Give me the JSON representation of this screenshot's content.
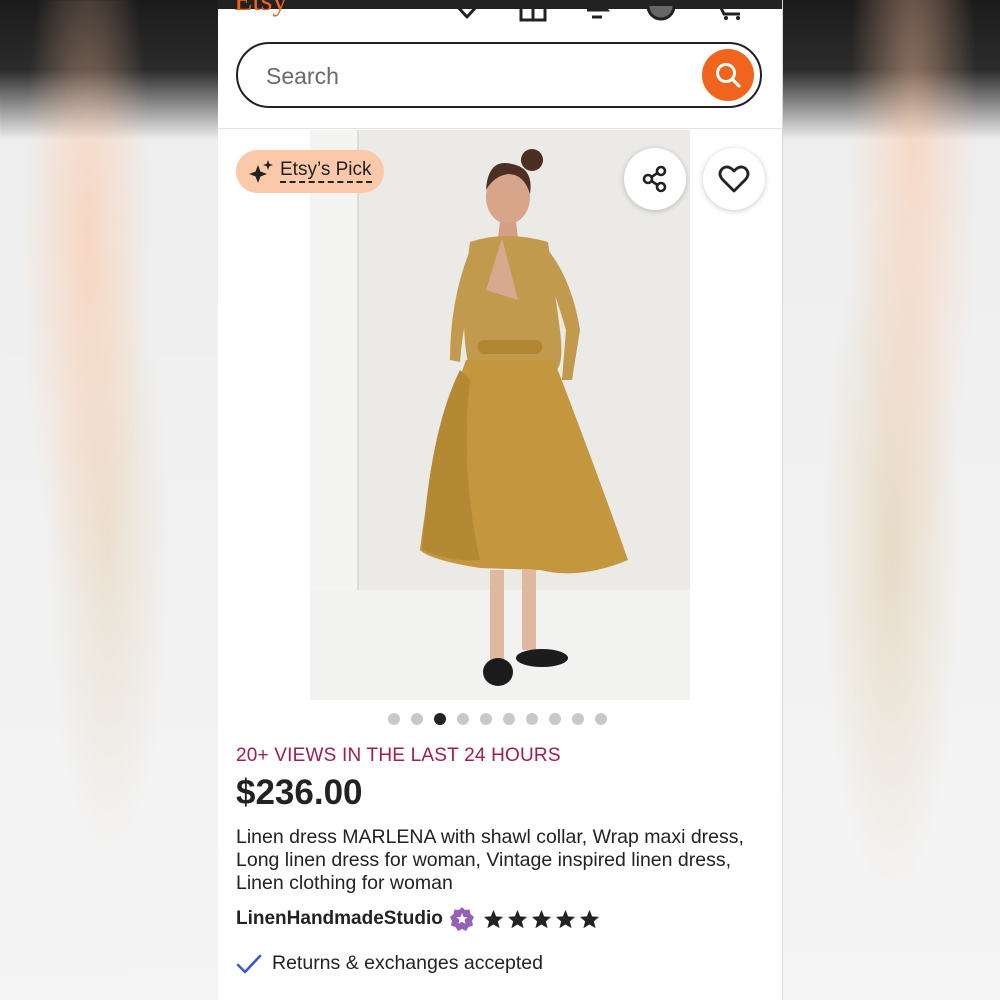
{
  "header": {
    "logo_text": "Etsy",
    "brand_color": "#f1641e",
    "icons": [
      "favorites-icon",
      "gift-icon",
      "notifications-icon",
      "account-icon",
      "cart-icon"
    ]
  },
  "search": {
    "placeholder": "Search",
    "value": ""
  },
  "listing": {
    "badge_label": "Etsy’s Pick",
    "badge_color": "#fbc9a9",
    "image_count": 10,
    "active_image_index": 2,
    "views_text": "20+ VIEWS IN THE LAST 24 HOURS",
    "views_color": "#a61a4f",
    "price": "$236.00",
    "title": "Linen dress MARLENA with shawl collar, Wrap maxi dress, Long linen dress for woman, Vintage inspired linen dress, Linen clothing for woman",
    "shop_name": "LinenHandmadeStudio",
    "rating_stars": 5,
    "returns_text": "Returns & exchanges accepted"
  }
}
